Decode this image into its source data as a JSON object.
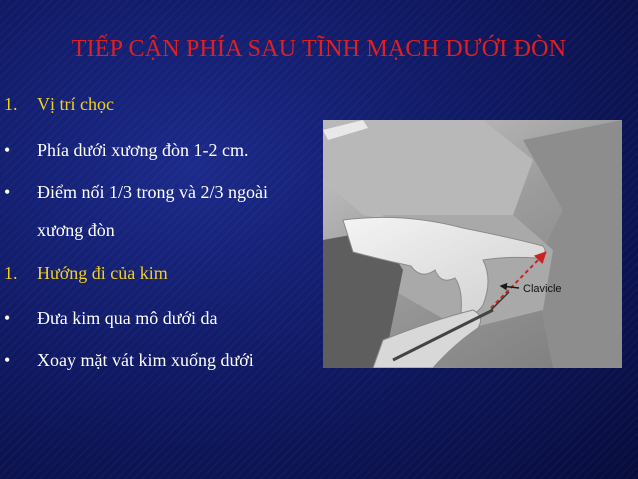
{
  "slide": {
    "title": "TIẾP CẬN PHÍA SAU TĨNH MẠCH DƯỚI ĐÒN",
    "items": [
      {
        "marker": "1.",
        "text": "Vị trí chọc"
      },
      {
        "marker": "•",
        "text": "Phía dưới xương đòn 1-2 cm."
      },
      {
        "marker": "•",
        "text": "Điểm nối 1/3 trong và 2/3 ngoài"
      },
      {
        "marker": "",
        "text": "xương đòn"
      },
      {
        "marker": "1.",
        "text": "Hướng đi của kim"
      },
      {
        "marker": "•",
        "text": "Đưa kim qua mô dưới da"
      },
      {
        "marker": "•",
        "text": "Xoay mặt vát kim xuống dưới"
      }
    ],
    "photo_label": "Clavicle"
  },
  "colors": {
    "background": "#101a66",
    "title": "#e02020",
    "heading": "#f2d11e",
    "body_text": "#ffffff",
    "arrow": "#cc2222"
  }
}
